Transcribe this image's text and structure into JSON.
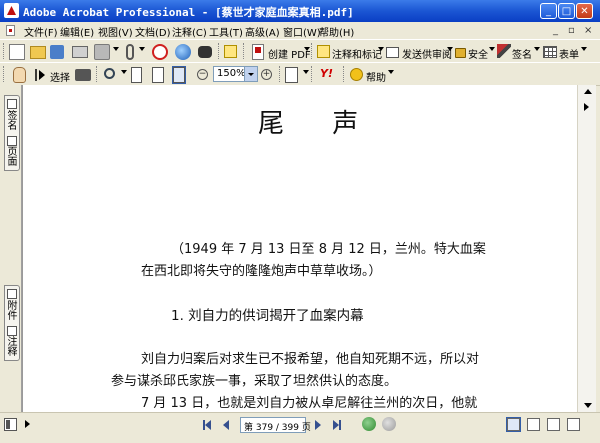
{
  "window": {
    "title": "Adobe Acrobat Professional - [蔡世才家庭血案真相.pdf]",
    "minimize_glyph": "_",
    "maximize_glyph": "□",
    "close_glyph": "✕"
  },
  "menu": {
    "items": [
      "文件(F)",
      "编辑(E)",
      "视图(V)",
      "文档(D)",
      "注释(C)",
      "工具(T)",
      "高级(A)",
      "窗口(W)",
      "帮助(H)"
    ],
    "mdi_controls": [
      "_",
      "▫",
      "×"
    ]
  },
  "toolbar1": {
    "create_pdf": "创建 PDF",
    "comment_markup": "注释和标记",
    "send_review": "发送供审阅",
    "security": "安全",
    "sign": "签名",
    "forms": "表单"
  },
  "toolbar2": {
    "select": "选择",
    "zoom_value": "150%",
    "help": "帮助"
  },
  "nav_tabs": {
    "pages_tab": "页面",
    "signatures_tab": "签名",
    "comments_tab": "注释",
    "attachments_tab": "附件"
  },
  "document": {
    "heading": "尾  声",
    "intro_line1": "（1949 年 7 月 13 日至 8 月 12 日，兰州。特大血案",
    "intro_line2": "在西北即将失守的隆隆炮声中草草收场。）",
    "section_title": "1. 刘自力的供词揭开了血案内幕",
    "para1_line1": "刘自力归案后对求生已不报希望，他自知死期不远，所以对",
    "para1_line2": "参与谋杀邱氏家族一事，采取了坦然供认的态度。",
    "para2_line1": "7 月 13 日，也就是刘自力被从卓尼解往兰州的次日，他就"
  },
  "status": {
    "page_indicator": "第 379 / 399 页"
  },
  "colors": {
    "titlebar": "#0a3ec4",
    "chrome": "#ece9d8",
    "page": "#ffffff"
  }
}
